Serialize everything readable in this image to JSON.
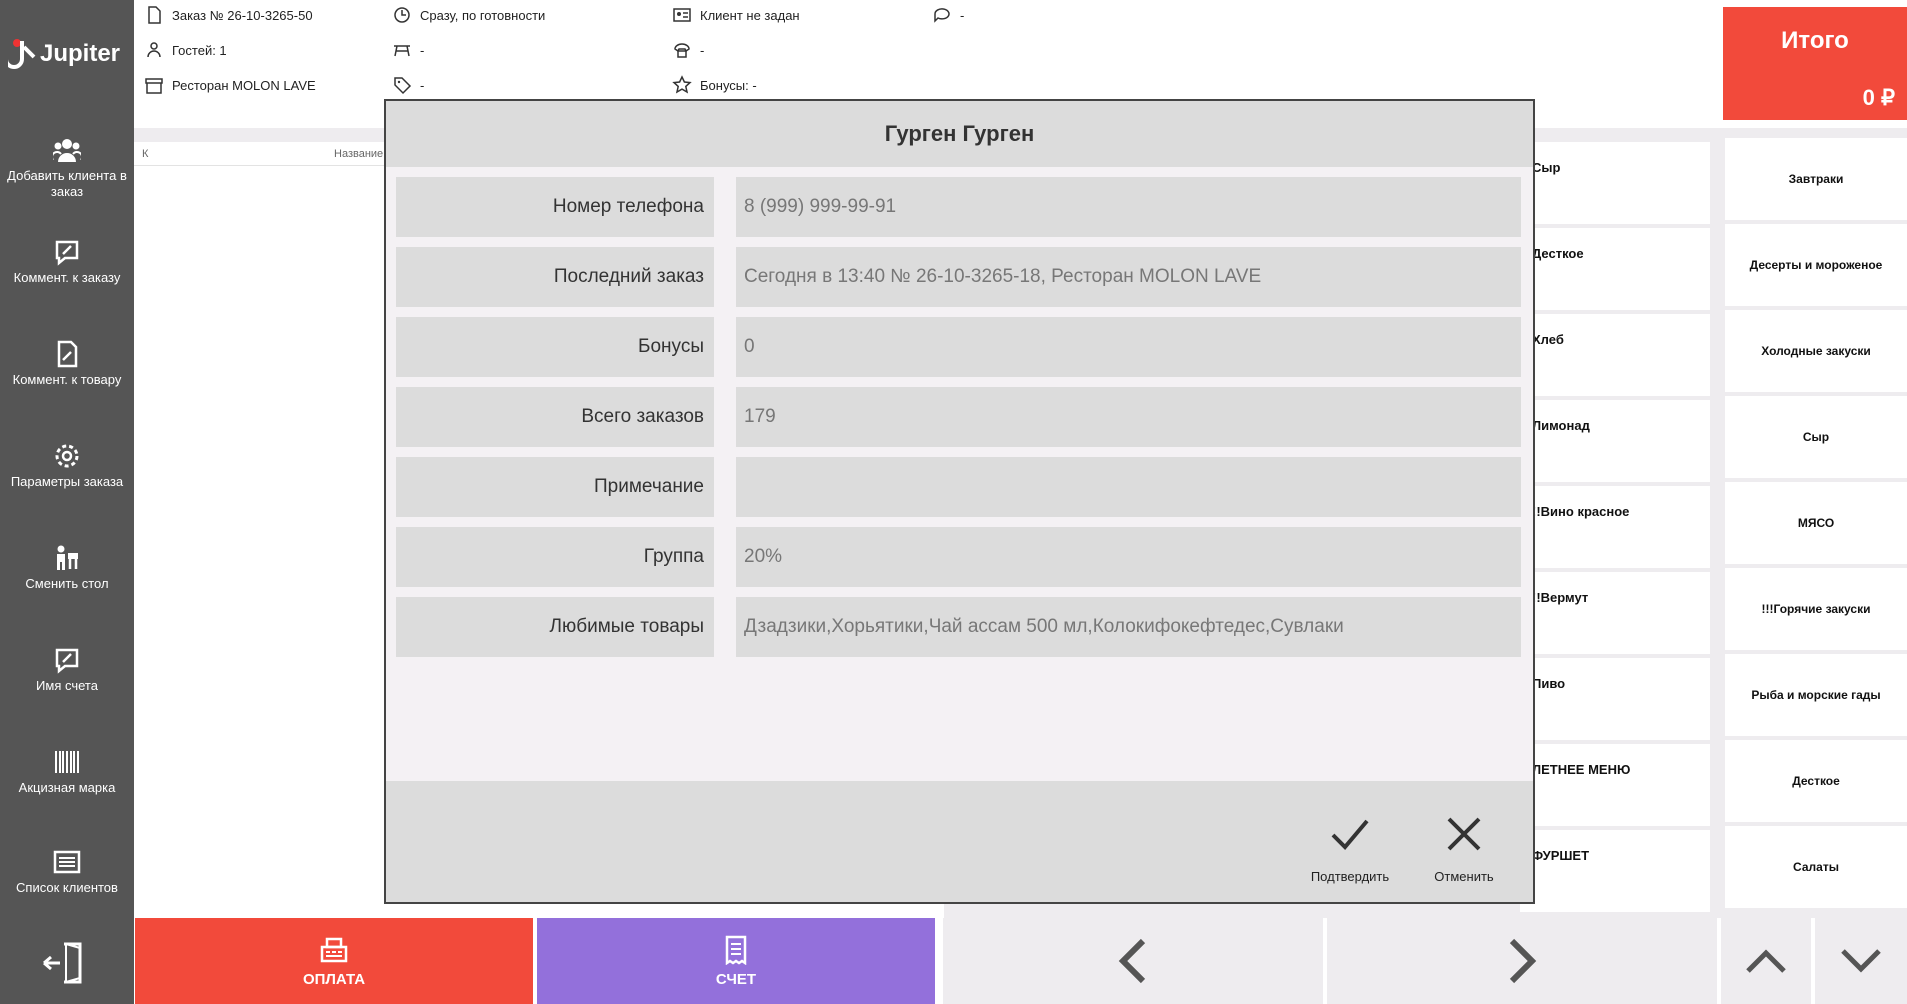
{
  "app": {
    "logo_text": "Jupiter"
  },
  "sidebar": {
    "items": [
      {
        "label": "Добавить клиента в заказ",
        "icon": "users-icon"
      },
      {
        "label": "Коммент. к заказу",
        "icon": "comment-edit-icon"
      },
      {
        "label": "Коммент. к товару",
        "icon": "file-edit-icon"
      },
      {
        "label": "Параметры заказа",
        "icon": "gear-icon"
      },
      {
        "label": "Сменить стол",
        "icon": "change-table-icon"
      },
      {
        "label": "Имя счета",
        "icon": "comment-edit-icon"
      },
      {
        "label": "Акцизная марка",
        "icon": "barcode-icon"
      },
      {
        "label": "Список клиентов",
        "icon": "list-icon"
      }
    ],
    "exit_icon": "exit-icon"
  },
  "header": {
    "order_number": "Заказ № 26-10-3265-50",
    "guests": "Гостей: 1",
    "restaurant": "Ресторан MOLON LAVE",
    "timing": "Сразу, по готовности",
    "table": "-",
    "tag": "-",
    "client": "Клиент не задан",
    "phone": "-",
    "bonuses": "Бонусы: -",
    "comment": "-"
  },
  "total": {
    "label": "Итого",
    "value": "0 ₽"
  },
  "order_table": {
    "col_k": "К",
    "col_name": "Название"
  },
  "categories_left": [
    "Сыр",
    "Десткое",
    "Хлеб",
    "Лимонад",
    "!!Вино красное",
    "!!Вермут",
    "Пиво",
    "ЛЕТНЕЕ МЕНЮ",
    "ФУРШЕТ"
  ],
  "categories_right": [
    "Завтраки",
    "Десерты и мороженое",
    "Холодные закуски",
    "Сыр",
    "МЯСО",
    "!!!Горячие закуски",
    "Рыба и морские гады",
    "Десткое",
    "Салаты"
  ],
  "bottom": {
    "pay_label": "ОПЛАТА",
    "bill_label": "СЧЕТ"
  },
  "modal": {
    "title": "Гурген Гурген",
    "rows": [
      {
        "label": "Номер телефона",
        "value": "8 (999) 999-99-91"
      },
      {
        "label": "Последний заказ",
        "value": "Сегодня в 13:40 № 26-10-3265-18, Ресторан MOLON LAVE"
      },
      {
        "label": "Бонусы",
        "value": "0"
      },
      {
        "label": "Всего заказов",
        "value": "179"
      },
      {
        "label": "Примечание",
        "value": ""
      },
      {
        "label": "Группа",
        "value": "20%"
      },
      {
        "label": "Любимые товары",
        "value": "Дзадзики,Хорьятики,Чай ассам 500 мл,Колокифокефтедес,Сувлаки"
      }
    ],
    "confirm_label": "Подтвердить",
    "cancel_label": "Отменить"
  },
  "colors": {
    "accent_red": "#f24a3b",
    "accent_purple": "#9370db",
    "sidebar": "#555555"
  }
}
